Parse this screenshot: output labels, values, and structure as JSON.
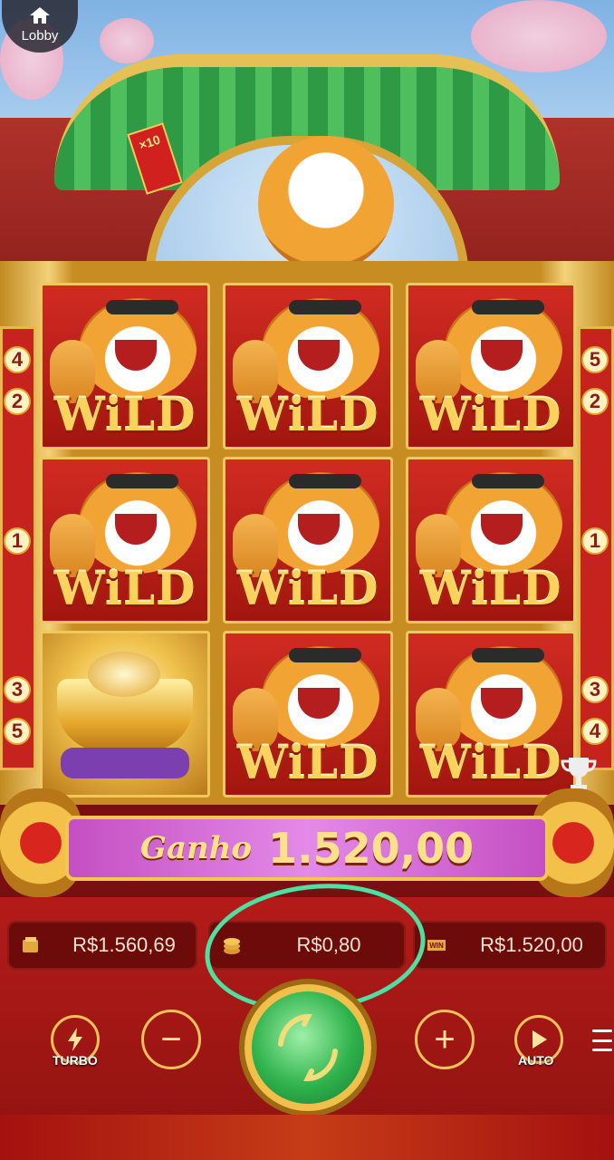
{
  "header": {
    "lobby_label": "Lobby",
    "lobby_icon": "home-icon"
  },
  "scene": {
    "envelope_text": "×10"
  },
  "reels": {
    "symbols": [
      [
        "WILD",
        "WILD",
        "WILD"
      ],
      [
        "WILD",
        "WILD",
        "WILD"
      ],
      [
        "gold-ingot",
        "WILD",
        "WILD"
      ]
    ],
    "wild_label": "WiLD"
  },
  "paylines": {
    "left": [
      "4",
      "2",
      "1",
      "3",
      "5"
    ],
    "right": [
      "5",
      "2",
      "1",
      "3",
      "4"
    ]
  },
  "win": {
    "label": "Ganho",
    "amount": "1.520,00"
  },
  "balances": {
    "balance": "R$1.560,69",
    "bet": "R$0,80",
    "last_win": "R$1.520,00",
    "balance_icon": "wallet-icon",
    "bet_icon": "coins-icon",
    "win_icon": "win-badge-icon",
    "win_badge_text": "WIN"
  },
  "controls": {
    "turbo_label": "TURBO",
    "auto_label": "AUTO",
    "minus_symbol": "−",
    "plus_symbol": "+",
    "menu_icon": "menu-icon",
    "spin_icon": "spin-icon"
  },
  "colors": {
    "highlight_ring": "#4ee0a0",
    "gold": "#f2c650",
    "banner": "#d877d8"
  }
}
